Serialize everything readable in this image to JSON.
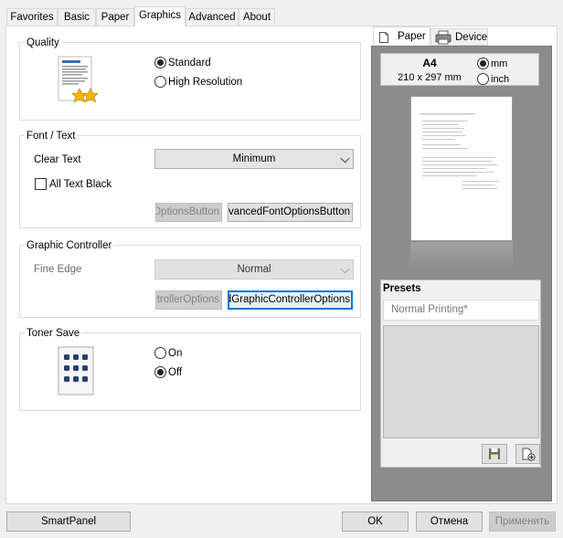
{
  "tabs": [
    "Favorites",
    "Basic",
    "Paper",
    "Graphics",
    "Advanced",
    "About"
  ],
  "active_tab": "Graphics",
  "quality": {
    "title": "Quality",
    "options": [
      "Standard",
      "High Resolution"
    ],
    "selected": "Standard"
  },
  "font_text": {
    "title": "Font / Text",
    "clear_text_label": "Clear Text",
    "clear_text_value": "Minimum",
    "all_text_black_label": "All Text Black",
    "all_text_black_checked": false,
    "btn1_label": "AdvancedFontOptionsButton",
    "btn2_label": "AdvancedFontOptionsButton"
  },
  "graphic_controller": {
    "title": "Graphic Controller",
    "fine_edge_label": "Fine Edge",
    "fine_edge_value": "Normal",
    "btn1_label": "AdvancedGraphicControllerOptions",
    "btn2_label": "AdvancedGraphicControllerOptions"
  },
  "toner_save": {
    "title": "Toner Save",
    "options": [
      "On",
      "Off"
    ],
    "selected": "Off"
  },
  "preview": {
    "tabs": [
      "Paper",
      "Device"
    ],
    "paper_size": "A4",
    "paper_dims": "210 x 297 mm",
    "units": [
      "mm",
      "inch"
    ],
    "selected_unit": "mm"
  },
  "presets": {
    "title": "Presets",
    "current": "Normal Printing*"
  },
  "footer": {
    "smartpanel": "SmartPanel",
    "ok": "OK",
    "cancel": "Отмена",
    "apply": "Применить"
  },
  "icons": [
    "document-stars-icon",
    "toner-dots-icon",
    "paper-tab-icon",
    "printer-device-icon",
    "save-preset-icon",
    "add-preset-icon",
    "chevron-down-icon"
  ],
  "colors": {
    "focus": "#0078d7",
    "preview_bg": "#8c8c8c",
    "disabled_bg": "#cccccc"
  }
}
